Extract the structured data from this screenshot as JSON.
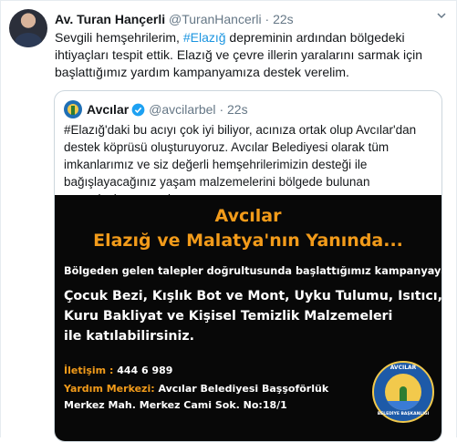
{
  "tweet": {
    "name": "Av. Turan Hançerli",
    "handle": "@TuranHancerli",
    "separator": "·",
    "time": "22s",
    "text_before": "Sevgili hemşehrilerim, ",
    "hashtag": "#Elazığ",
    "text_after": " depreminin ardından bölgedeki ihtiyaçları tespit ettik. Elazığ ve çevre illerin yaralarını sarmak için başlattığımız yardım kampanyamıza destek verelim."
  },
  "quoted": {
    "name": "Avcılar",
    "handle": "@avcilarbel",
    "separator": "·",
    "time": "22s",
    "text": "#Elazığ'daki bu acıyı çok iyi biliyor, acınıza ortak olup Avcılar'dan destek köprüsü oluşturuyoruz. Avcılar Belediyesi olarak tüm imkanlarımız ve siz değerli hemşehrilerimizin desteği ile bağışlayacağınız yaşam malzemelerini bölgede bulunan vatandaşlarımıza ulaştırıyoruz."
  },
  "poster": {
    "title1": "Avcılar",
    "title2": "Elazığ ve Malatya'nın Yanında...",
    "line1": "Bölgeden gelen talepler doğrultusunda  başlattığımız kampanyaya",
    "big1": "Çocuk Bezi, Kışlık Bot ve Mont, Uyku Tulumu, Isıtıcı,",
    "big2": "Kuru Bakliyat ve Kişisel Temizlik Malzemeleri",
    "big3": "ile katılabilirsiniz.",
    "contact_label": "İletişim :",
    "contact_value": "444 6 989",
    "center_label": "Yardım Merkezi:",
    "center_value": "Avcılar Belediyesi Başşoförlük",
    "address": "Merkez Mah. Merkez Cami Sok. No:18/1",
    "logo_top": "AVCILAR",
    "logo_bottom": "BELEDİYE BAŞKANLIĞI"
  },
  "icons": {
    "chevron": "chevron-down-icon",
    "verified": "verified-badge-icon"
  },
  "colors": {
    "link": "#1b95e0",
    "muted": "#657786",
    "poster_accent": "#f29b1a"
  }
}
